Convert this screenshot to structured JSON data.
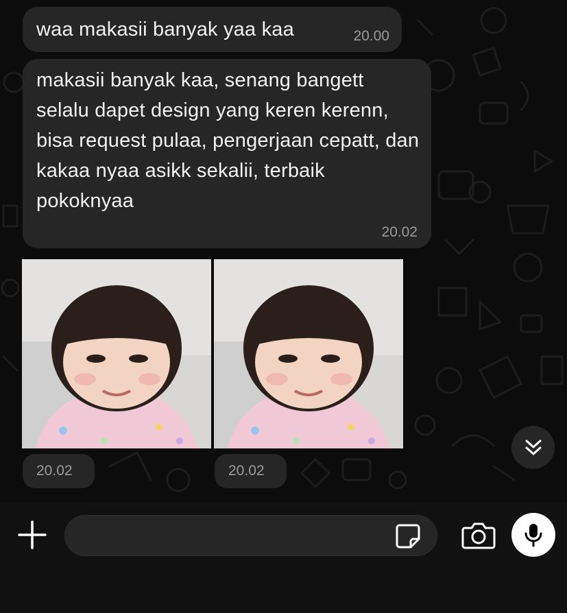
{
  "messages": [
    {
      "text": "waa makasii banyak yaa kaa",
      "time": "20.00"
    },
    {
      "text": "makasii banyak kaa, senang bangett selalu dapet design yang keren kerenn, bisa request pulaa, pengerjaan cepatt, dan kakaa nyaa asikk sekalii, terbaik pokoknyaa",
      "time": "20.02"
    }
  ],
  "photos": [
    {
      "time": "20.02",
      "icon": "girl-portrait-photo"
    },
    {
      "time": "20.02",
      "icon": "girl-portrait-photo"
    }
  ],
  "input": {
    "placeholder": "",
    "value": ""
  },
  "icons": {
    "plus": "plus-icon",
    "sticker": "sticker-icon",
    "camera": "camera-icon",
    "mic": "microphone-icon",
    "scroll": "double-chevron-down-icon"
  },
  "colors": {
    "background": "#0c0c0c",
    "bubble": "#262626",
    "time": "#9a9a9a",
    "mic_button": "#ffffff"
  }
}
